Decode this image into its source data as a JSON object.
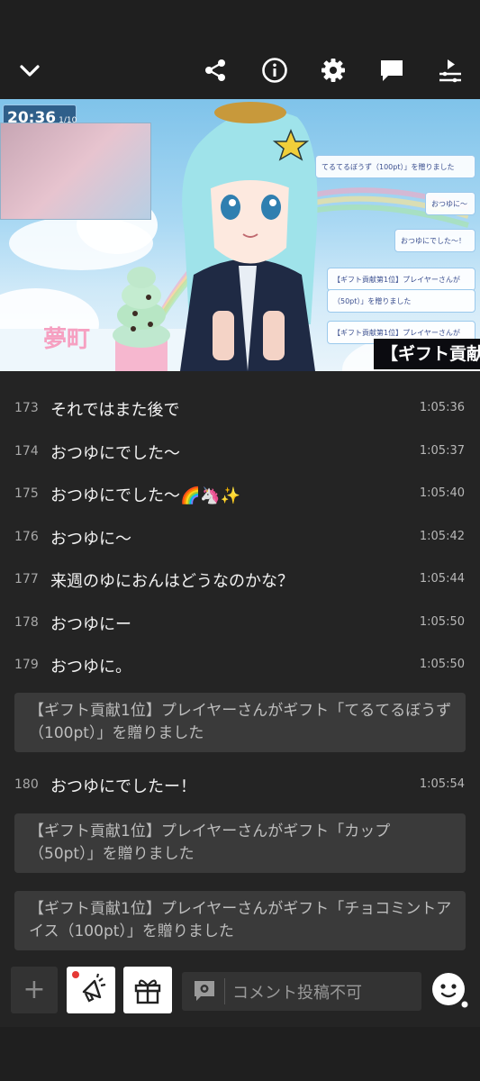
{
  "topbar": {
    "icons": [
      "chevron-down-icon",
      "share-icon",
      "info-icon",
      "gear-icon",
      "comment-icon",
      "playlist-icon"
    ]
  },
  "video": {
    "clock_time": "20:36",
    "clock_date": "1/10",
    "chat_lines": [
      "てるてるぼうず（100pt）」を贈りました",
      "おつゆに〜",
      "おつゆにでした〜！",
      "【ギフト貢献第1位】プレイヤーさんが",
      "（50pt）」を贈りました",
      "【ギフト貢献第1位】プレイヤーさんが"
    ],
    "banner": "【ギフト貢献"
  },
  "chat": {
    "rows": [
      {
        "num": "173",
        "text": "それではまた後で",
        "time": "1:05:36"
      },
      {
        "num": "174",
        "text": "おつゆにでした〜",
        "time": "1:05:37"
      },
      {
        "num": "175",
        "text": "おつゆにでした〜🌈🦄✨",
        "time": "1:05:40"
      },
      {
        "num": "176",
        "text": "おつゆに〜",
        "time": "1:05:42"
      },
      {
        "num": "177",
        "text": "来週のゆにおんはどうなのかな？",
        "time": "1:05:44"
      },
      {
        "num": "178",
        "text": "おつゆにー",
        "time": "1:05:50"
      },
      {
        "num": "179",
        "text": "おつゆに。",
        "time": "1:05:50"
      },
      {
        "num": "180",
        "text": "おつゆにでしたー！",
        "time": "1:05:54"
      }
    ],
    "gifts": [
      "【ギフト貢献1位】プレイヤーさんがギフト「てるてるぼうず（100pt）」を贈りました",
      "【ギフト貢献1位】プレイヤーさんがギフト「カップ（50pt）」を贈りました",
      "【ギフト貢献1位】プレイヤーさんがギフト「チョコミントアイス（100pt）」を贈りました"
    ]
  },
  "bottom": {
    "plus": "+",
    "comment_placeholder": "コメント投稿不可",
    "icons": [
      "plus-icon",
      "megaphone-icon",
      "gift-icon",
      "comment-settings-icon",
      "emoji-face-icon"
    ]
  },
  "colors": {
    "background": "#242424",
    "topbar": "#1f1f1f",
    "gift_box": "#3a3a3a",
    "notify_dot": "#e53935"
  }
}
